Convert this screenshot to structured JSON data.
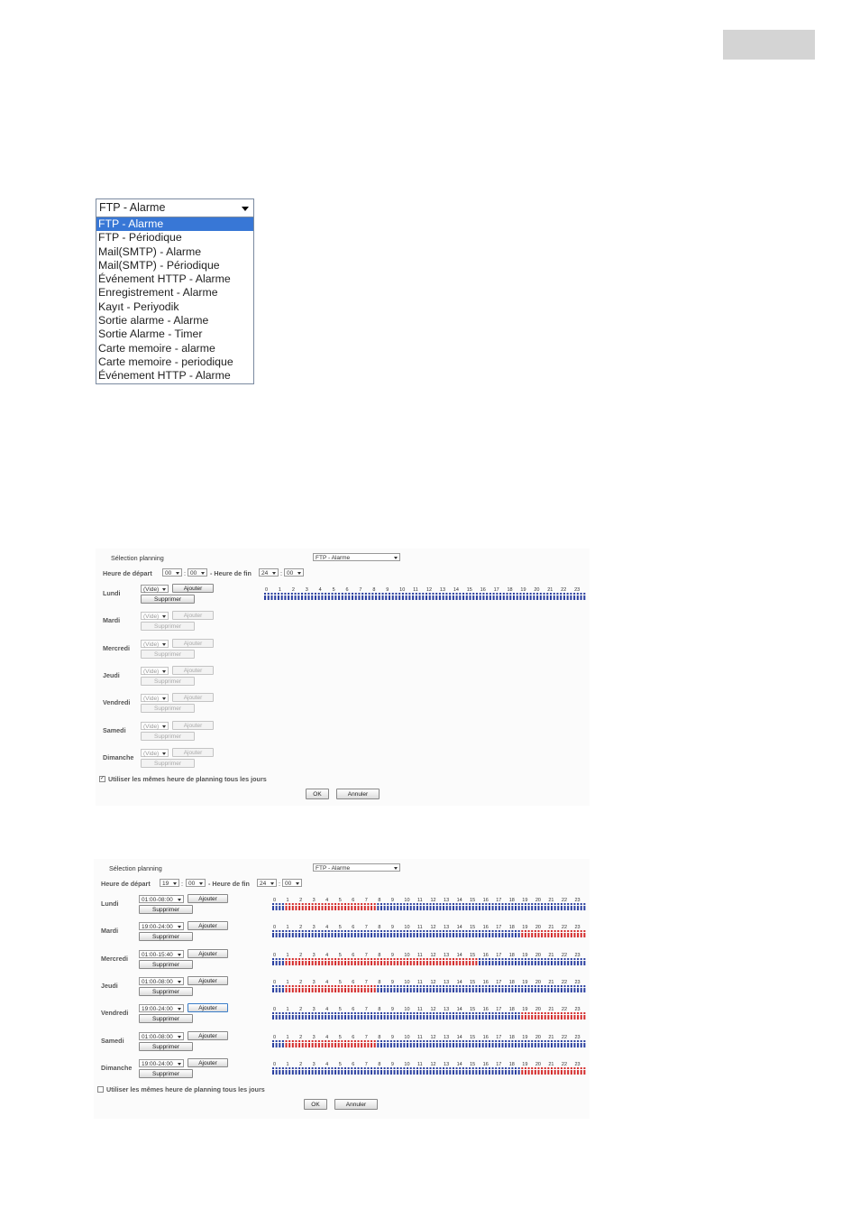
{
  "dropdown": {
    "selected": "FTP - Alarme",
    "options": [
      "FTP - Alarme",
      "FTP - Périodique",
      "Mail(SMTP) - Alarme",
      "Mail(SMTP) - Périodique",
      "Événement HTTP - Alarme",
      "Enregistrement - Alarme",
      "Kayıt - Periyodik",
      "Sortie alarme - Alarme",
      "Sortie Alarme - Timer",
      "Carte memoire - alarme",
      "Carte memoire - periodique",
      "Événement HTTP - Alarme"
    ]
  },
  "colors": {
    "selection": "#3877d6",
    "timeline_blue": "#2a3fa0",
    "timeline_red": "#d42a2a",
    "grey_tab": "#d4d4d4"
  },
  "hours": [
    "0",
    "1",
    "2",
    "3",
    "4",
    "5",
    "6",
    "7",
    "8",
    "9",
    "10",
    "11",
    "12",
    "13",
    "14",
    "15",
    "16",
    "17",
    "18",
    "19",
    "20",
    "21",
    "22",
    "23"
  ],
  "panel1": {
    "selection_label": "Sélection planning",
    "selection_value": "FTP - Alarme",
    "start_label": "Heure de départ",
    "start_h": "00",
    "start_m": "00",
    "end_label": "- Heure de fin",
    "end_h": "24",
    "end_m": "00",
    "add_label": "Ajouter",
    "delete_label": "Supprimer",
    "days": [
      {
        "name": "Lundi",
        "entry": "(Vide)"
      },
      {
        "name": "Mardi",
        "entry": "(Vide)"
      },
      {
        "name": "Mercredi",
        "entry": "(Vide)"
      },
      {
        "name": "Jeudi",
        "entry": "(Vide)"
      },
      {
        "name": "Vendredi",
        "entry": "(Vide)"
      },
      {
        "name": "Samedi",
        "entry": "(Vide)"
      },
      {
        "name": "Dimanche",
        "entry": "(Vide)"
      }
    ],
    "same_schedule_label": "Utiliser les mêmes heure de planning tous les jours",
    "same_schedule_checked": true,
    "ok_label": "OK",
    "cancel_label": "Annuler"
  },
  "panel2": {
    "selection_label": "Sélection planning",
    "selection_value": "FTP - Alarme",
    "start_label": "Heure de départ",
    "start_h": "19",
    "start_m": "00",
    "end_label": "- Heure de fin",
    "end_h": "24",
    "end_m": "00",
    "add_label": "Ajouter",
    "delete_label": "Supprimer",
    "days": [
      {
        "name": "Lundi",
        "entry": "01:00-08:00",
        "red_ranges": [
          [
            1,
            8
          ]
        ]
      },
      {
        "name": "Mardi",
        "entry": "19:00-24:00",
        "red_ranges": [
          [
            19,
            24
          ]
        ]
      },
      {
        "name": "Mercredi",
        "entry": "01:00-15:40",
        "red_ranges": [
          [
            1,
            15.67
          ]
        ]
      },
      {
        "name": "Jeudi",
        "entry": "01:00-08:00",
        "red_ranges": [
          [
            1,
            8
          ]
        ]
      },
      {
        "name": "Vendredi",
        "entry": "19:00-24:00",
        "red_ranges": [
          [
            19,
            24
          ]
        ]
      },
      {
        "name": "Samedi",
        "entry": "01:00-08:00",
        "red_ranges": [
          [
            1,
            8
          ]
        ]
      },
      {
        "name": "Dimanche",
        "entry": "19:00-24:00",
        "red_ranges": [
          [
            19,
            24
          ]
        ]
      }
    ],
    "same_schedule_label": "Utiliser les mêmes heure de planning tous les jours",
    "same_schedule_checked": false,
    "ok_label": "OK",
    "cancel_label": "Annuler"
  }
}
